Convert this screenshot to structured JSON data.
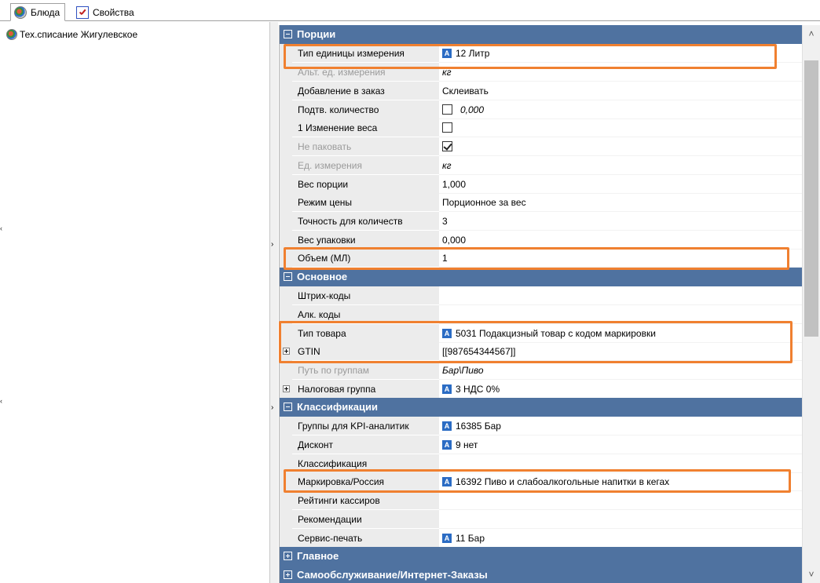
{
  "tabs": [
    {
      "label": "Блюда",
      "icon": "dish-icon",
      "active": true
    },
    {
      "label": "Свойства",
      "icon": "properties-icon",
      "active": false
    }
  ],
  "tree": {
    "item_label": "Тех.списание Жигулевское"
  },
  "grid": {
    "categories": {
      "portions": "Порции",
      "main": "Основное",
      "classification": "Классификации",
      "general": "Главное",
      "selfservice": "Самообслуживание/Интернет-Заказы"
    },
    "rows": {
      "unit_type": {
        "name": "Тип единицы измерения",
        "value": "12 Литр"
      },
      "alt_unit": {
        "name": "Альт. ед. измерения",
        "value": "кг"
      },
      "add_to_order": {
        "name": "Добавление в заказ",
        "value": "Склеивать"
      },
      "confirm_qty": {
        "name": "Подтв. количество",
        "value": "0,000"
      },
      "weight_change": {
        "name": "1 Изменение веса"
      },
      "no_pack": {
        "name": "Не паковать"
      },
      "unit": {
        "name": "Ед. измерения",
        "value": "кг"
      },
      "portion_weight": {
        "name": "Вес порции",
        "value": "1,000"
      },
      "price_mode": {
        "name": "Режим цены",
        "value": "Порционное за вес"
      },
      "qty_precision": {
        "name": "Точность для количеств",
        "value": "3"
      },
      "pack_weight": {
        "name": "Вес упаковки",
        "value": "0,000"
      },
      "volume": {
        "name": "Объем (МЛ)",
        "value": "1"
      },
      "barcodes": {
        "name": "Штрих-коды",
        "value": ""
      },
      "alc_codes": {
        "name": "Алк. коды",
        "value": ""
      },
      "product_type": {
        "name": "Тип товара",
        "value": "5031 Подакцизный товар с кодом маркировки"
      },
      "gtin": {
        "name": "GTIN",
        "value": "[[987654344567]]"
      },
      "group_path": {
        "name": "Путь по группам",
        "value": "Бар\\Пиво"
      },
      "tax_group": {
        "name": "Налоговая группа",
        "value": "3 НДС 0%"
      },
      "kpi_groups": {
        "name": "Группы для KPI-аналитик",
        "value": "16385 Бар"
      },
      "discount": {
        "name": "Дисконт",
        "value": "9 нет"
      },
      "classification": {
        "name": "Классификация",
        "value": ""
      },
      "marking_russia": {
        "name": "Маркировка/Россия",
        "value": "16392 Пиво и слабоалкогольные напитки в кегах"
      },
      "cashier_ratings": {
        "name": "Рейтинги кассиров",
        "value": ""
      },
      "recommendations": {
        "name": "Рекомендации",
        "value": ""
      },
      "service_print": {
        "name": "Сервис-печать",
        "value": "11 Бар"
      }
    }
  },
  "colors": {
    "category_bg": "#4f72a0",
    "highlight": "#f08030",
    "ref_icon": "#2b6cc4"
  }
}
